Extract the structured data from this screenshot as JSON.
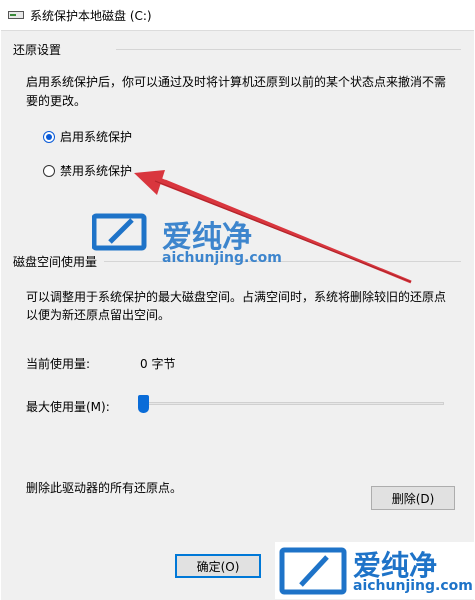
{
  "window": {
    "title": "系统保护本地磁盘 (C:)"
  },
  "restore": {
    "group_title": "还原设置",
    "description": [
      "启用系统保护后，你可以通过及时将计算机还原到以前的某个状态点来撤消不需",
      "要的更改。"
    ],
    "options": [
      {
        "label": "启用系统保护",
        "checked": true
      },
      {
        "label": "禁用系统保护",
        "checked": false
      }
    ]
  },
  "disk": {
    "group_title": "磁盘空间使用量",
    "description": [
      "可以调整用于系统保护的最大磁盘空间。占满空间时，系统将删除较旧的还原点",
      "以便为新还原点留出空间。"
    ],
    "current_label": "当前使用量:",
    "current_value": "0 字节",
    "max_label": "最大使用量(M):",
    "max_fraction": 0.0
  },
  "delete": {
    "label": "删除此驱动器的所有还原点。",
    "button": "删除(D)"
  },
  "footer": {
    "ok": "确定(O)"
  },
  "watermark": {
    "text": "爱纯净",
    "url": "aichunjing.com"
  },
  "colors": {
    "accent": "#0a5bd8",
    "arrow": "#d9363e",
    "watermark": "#1e73c8"
  }
}
